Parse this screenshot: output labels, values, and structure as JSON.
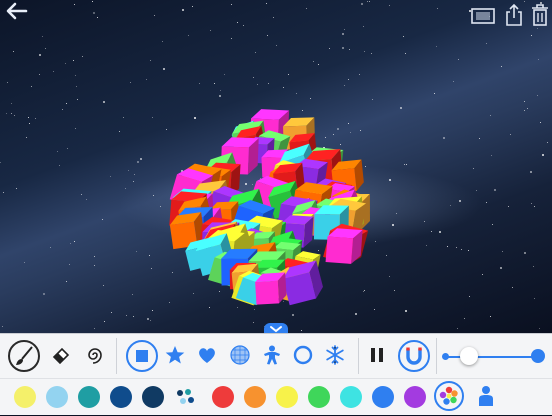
{
  "top_bar": {
    "back_icon": "arrow-left-icon",
    "right_icons": [
      "screen-frame-icon",
      "share-icon",
      "trash-icon"
    ]
  },
  "cube_colors": [
    "#e8e82a",
    "#3ad0e8",
    "#ff2bd0",
    "#27c23c",
    "#1e63ff",
    "#8a2be2",
    "#ff6a00",
    "#e21b1b",
    "#5dd35a",
    "#f0a030"
  ],
  "toolbar": {
    "tools": [
      "brush-icon",
      "eraser-icon",
      "swirl-icon"
    ],
    "shapes": [
      "square-icon",
      "star-icon",
      "heart-icon",
      "sphere-grid-icon",
      "gingerbread-man-icon",
      "ring-icon",
      "snowflake-icon"
    ],
    "controls": [
      "pause-icon",
      "magnet-icon"
    ],
    "accent": "#2f7ff0"
  },
  "slider": {
    "value": 0.25
  },
  "palette": {
    "colors": [
      "#f4f06a",
      "#93d3f0",
      "#1f9ea3",
      "#0f4c8c",
      "#103a63",
      "multi",
      "#ee3b3b",
      "#f7922f",
      "#f7f24a",
      "#3fd65a",
      "#3ee3e2",
      "#2f7ff0",
      "#a33be0"
    ],
    "extra_icons": [
      "color-wheel-icon",
      "person-icon"
    ]
  }
}
